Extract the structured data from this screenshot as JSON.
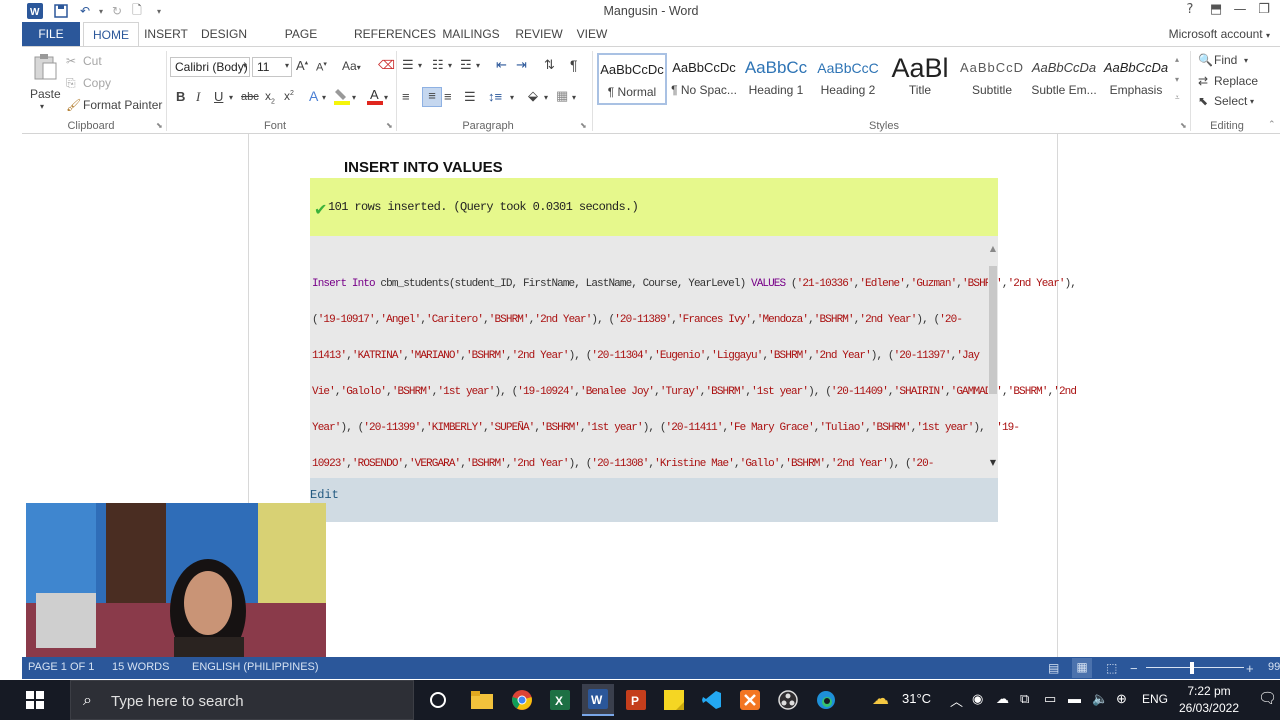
{
  "window": {
    "title": "Mangusin - Word",
    "help": "?",
    "account": "Microsoft account"
  },
  "tabs": [
    "FILE",
    "HOME",
    "INSERT",
    "DESIGN",
    "PAGE LAYOUT",
    "REFERENCES",
    "MAILINGS",
    "REVIEW",
    "VIEW"
  ],
  "ribbon": {
    "clipboard": {
      "paste": "Paste",
      "cut": "Cut",
      "copy": "Copy",
      "format_painter": "Format Painter",
      "label": "Clipboard"
    },
    "font": {
      "name": "Calibri (Body)",
      "size": "11",
      "label": "Font",
      "case": "Aa"
    },
    "paragraph": {
      "label": "Paragraph"
    },
    "styles": {
      "label": "Styles",
      "items": [
        {
          "sample": "AaBbCcDc",
          "name": "¶ Normal"
        },
        {
          "sample": "AaBbCcDc",
          "name": "¶ No Spac..."
        },
        {
          "sample": "AaBbCc",
          "name": "Heading 1"
        },
        {
          "sample": "AaBbCcC",
          "name": "Heading 2"
        },
        {
          "sample": "AaBl",
          "name": "Title"
        },
        {
          "sample": "AaBbCcD",
          "name": "Subtitle"
        },
        {
          "sample": "AaBbCcDa",
          "name": "Subtle Em..."
        },
        {
          "sample": "AaBbCcDa",
          "name": "Emphasis"
        }
      ]
    },
    "editing": {
      "find": "Find",
      "replace": "Replace",
      "select": "Select",
      "label": "Editing"
    }
  },
  "document": {
    "heading": "INSERT INTO VALUES",
    "success_message": "101 rows inserted. (Query took 0.0301 seconds.)",
    "sql_lines": [
      [
        {
          "t": "Insert Into",
          "c": "kw"
        },
        {
          "t": " cbm_students(student_ID, FirstName, LastName, Course, YearLevel) ",
          "c": ""
        },
        {
          "t": "VALUES",
          "c": "kw"
        },
        {
          "t": " (",
          "c": ""
        },
        {
          "t": "'21-10336'",
          "c": "str"
        },
        {
          "t": ",",
          "c": ""
        },
        {
          "t": "'Edlene'",
          "c": "str"
        },
        {
          "t": ",",
          "c": ""
        },
        {
          "t": "'Guzman'",
          "c": "str"
        },
        {
          "t": ",",
          "c": ""
        },
        {
          "t": "'BSHRM'",
          "c": "str"
        },
        {
          "t": ",",
          "c": ""
        },
        {
          "t": "'2nd Year'",
          "c": "str"
        },
        {
          "t": "),",
          "c": ""
        }
      ],
      [
        {
          "t": "(",
          "c": ""
        },
        {
          "t": "'19-10917'",
          "c": "str"
        },
        {
          "t": ",",
          "c": ""
        },
        {
          "t": "'Angel'",
          "c": "str"
        },
        {
          "t": ",",
          "c": ""
        },
        {
          "t": "'Caritero'",
          "c": "str"
        },
        {
          "t": ",",
          "c": ""
        },
        {
          "t": "'BSHRM'",
          "c": "str"
        },
        {
          "t": ",",
          "c": ""
        },
        {
          "t": "'2nd Year'",
          "c": "str"
        },
        {
          "t": "), (",
          "c": ""
        },
        {
          "t": "'20-11389'",
          "c": "str"
        },
        {
          "t": ",",
          "c": ""
        },
        {
          "t": "'Frances Ivy'",
          "c": "str"
        },
        {
          "t": ",",
          "c": ""
        },
        {
          "t": "'Mendoza'",
          "c": "str"
        },
        {
          "t": ",",
          "c": ""
        },
        {
          "t": "'BSHRM'",
          "c": "str"
        },
        {
          "t": ",",
          "c": ""
        },
        {
          "t": "'2nd Year'",
          "c": "str"
        },
        {
          "t": "), (",
          "c": ""
        },
        {
          "t": "'20-",
          "c": "str"
        }
      ],
      [
        {
          "t": "11413'",
          "c": "str"
        },
        {
          "t": ",",
          "c": ""
        },
        {
          "t": "'KATRINA'",
          "c": "str"
        },
        {
          "t": ",",
          "c": ""
        },
        {
          "t": "'MARIANO'",
          "c": "str"
        },
        {
          "t": ",",
          "c": ""
        },
        {
          "t": "'BSHRM'",
          "c": "str"
        },
        {
          "t": ",",
          "c": ""
        },
        {
          "t": "'2nd Year'",
          "c": "str"
        },
        {
          "t": "), (",
          "c": ""
        },
        {
          "t": "'20-11304'",
          "c": "str"
        },
        {
          "t": ",",
          "c": ""
        },
        {
          "t": "'Eugenio'",
          "c": "str"
        },
        {
          "t": ",",
          "c": ""
        },
        {
          "t": "'Liggayu'",
          "c": "str"
        },
        {
          "t": ",",
          "c": ""
        },
        {
          "t": "'BSHRM'",
          "c": "str"
        },
        {
          "t": ",",
          "c": ""
        },
        {
          "t": "'2nd Year'",
          "c": "str"
        },
        {
          "t": "), (",
          "c": ""
        },
        {
          "t": "'20-11397'",
          "c": "str"
        },
        {
          "t": ",",
          "c": ""
        },
        {
          "t": "'Jay",
          "c": "str"
        }
      ],
      [
        {
          "t": "Vie'",
          "c": "str"
        },
        {
          "t": ",",
          "c": ""
        },
        {
          "t": "'Galolo'",
          "c": "str"
        },
        {
          "t": ",",
          "c": ""
        },
        {
          "t": "'BSHRM'",
          "c": "str"
        },
        {
          "t": ",",
          "c": ""
        },
        {
          "t": "'1st year'",
          "c": "str"
        },
        {
          "t": "), (",
          "c": ""
        },
        {
          "t": "'19-10924'",
          "c": "str"
        },
        {
          "t": ",",
          "c": ""
        },
        {
          "t": "'Benalee Joy'",
          "c": "str"
        },
        {
          "t": ",",
          "c": ""
        },
        {
          "t": "'Turay'",
          "c": "str"
        },
        {
          "t": ",",
          "c": ""
        },
        {
          "t": "'BSHRM'",
          "c": "str"
        },
        {
          "t": ",",
          "c": ""
        },
        {
          "t": "'1st year'",
          "c": "str"
        },
        {
          "t": "), (",
          "c": ""
        },
        {
          "t": "'20-11409'",
          "c": "str"
        },
        {
          "t": ",",
          "c": ""
        },
        {
          "t": "'SHAIRIN'",
          "c": "str"
        },
        {
          "t": ",",
          "c": ""
        },
        {
          "t": "'GAMMAD '",
          "c": "str"
        },
        {
          "t": ",",
          "c": ""
        },
        {
          "t": "'BSHRM'",
          "c": "str"
        },
        {
          "t": ",",
          "c": ""
        },
        {
          "t": "'2nd",
          "c": "str"
        }
      ],
      [
        {
          "t": "Year'",
          "c": "str"
        },
        {
          "t": "), (",
          "c": ""
        },
        {
          "t": "'20-11399'",
          "c": "str"
        },
        {
          "t": ",",
          "c": ""
        },
        {
          "t": "'KIMBERLY'",
          "c": "str"
        },
        {
          "t": ",",
          "c": ""
        },
        {
          "t": "'SUPEÑA'",
          "c": "str"
        },
        {
          "t": ",",
          "c": ""
        },
        {
          "t": "'BSHRM'",
          "c": "str"
        },
        {
          "t": ",",
          "c": ""
        },
        {
          "t": "'1st year'",
          "c": "str"
        },
        {
          "t": "), (",
          "c": ""
        },
        {
          "t": "'20-11411'",
          "c": "str"
        },
        {
          "t": ",",
          "c": ""
        },
        {
          "t": "'Fe Mary Grace'",
          "c": "str"
        },
        {
          "t": ",",
          "c": ""
        },
        {
          "t": "'Tuliao'",
          "c": "str"
        },
        {
          "t": ",",
          "c": ""
        },
        {
          "t": "'BSHRM'",
          "c": "str"
        },
        {
          "t": ",",
          "c": ""
        },
        {
          "t": "'1st year'",
          "c": "str"
        },
        {
          "t": "), (",
          "c": ""
        },
        {
          "t": "'19-",
          "c": "str"
        }
      ],
      [
        {
          "t": "10923'",
          "c": "str"
        },
        {
          "t": ",",
          "c": ""
        },
        {
          "t": "'ROSENDO'",
          "c": "str"
        },
        {
          "t": ",",
          "c": ""
        },
        {
          "t": "'VERGARA'",
          "c": "str"
        },
        {
          "t": ",",
          "c": ""
        },
        {
          "t": "'BSHRM'",
          "c": "str"
        },
        {
          "t": ",",
          "c": ""
        },
        {
          "t": "'2nd Year'",
          "c": "str"
        },
        {
          "t": "), (",
          "c": ""
        },
        {
          "t": "'20-11308'",
          "c": "str"
        },
        {
          "t": ",",
          "c": ""
        },
        {
          "t": "'Kristine Mae'",
          "c": "str"
        },
        {
          "t": ",",
          "c": ""
        },
        {
          "t": "'Gallo'",
          "c": "str"
        },
        {
          "t": ",",
          "c": ""
        },
        {
          "t": "'BSHRM'",
          "c": "str"
        },
        {
          "t": ",",
          "c": ""
        },
        {
          "t": "'2nd Year'",
          "c": "str"
        },
        {
          "t": "), (",
          "c": ""
        },
        {
          "t": "'20-",
          "c": "str"
        }
      ]
    ],
    "edit_link": "Edit"
  },
  "statusbar": {
    "page": "PAGE 1 OF 1",
    "words": "15 WORDS",
    "language": "ENGLISH (PHILIPPINES)",
    "zoom": "99"
  },
  "taskbar": {
    "search_placeholder": "Type here to search",
    "temperature": "31°C",
    "language": "ENG",
    "time": "7:22 pm",
    "date": "26/03/2022"
  },
  "colors": {
    "word_blue": "#2b579a",
    "success_bg": "#e6f88c",
    "sql_bg": "#e8e8e8",
    "keyword": "#770088",
    "string": "#aa1111"
  }
}
